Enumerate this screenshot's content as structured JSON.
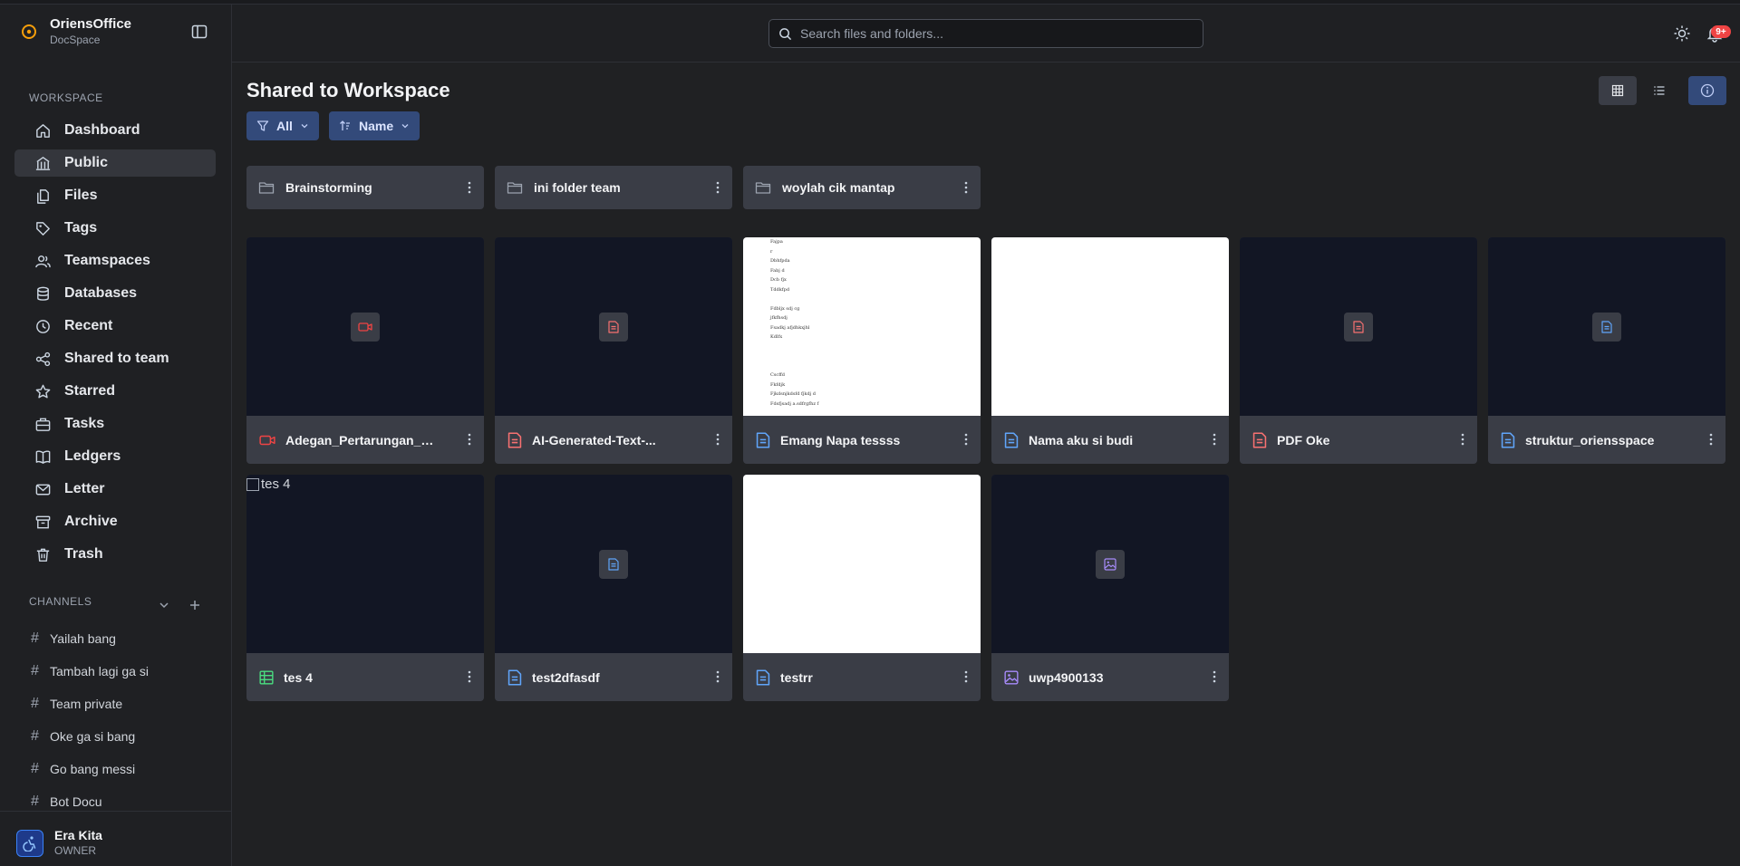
{
  "app": {
    "name": "OriensOffice",
    "product": "DocSpace"
  },
  "sidebar": {
    "workspace_title": "WORKSPACE",
    "items": [
      {
        "label": "Dashboard",
        "icon": "home-icon"
      },
      {
        "label": "Public",
        "icon": "building-icon",
        "active": true
      },
      {
        "label": "Files",
        "icon": "files-icon"
      },
      {
        "label": "Tags",
        "icon": "tag-icon"
      },
      {
        "label": "Teamspaces",
        "icon": "users-icon"
      },
      {
        "label": "Databases",
        "icon": "database-icon"
      },
      {
        "label": "Recent",
        "icon": "clock-icon"
      },
      {
        "label": "Shared to team",
        "icon": "share-icon"
      },
      {
        "label": "Starred",
        "icon": "star-icon"
      },
      {
        "label": "Tasks",
        "icon": "briefcase-icon"
      },
      {
        "label": "Ledgers",
        "icon": "book-icon"
      },
      {
        "label": "Letter",
        "icon": "mail-icon"
      },
      {
        "label": "Archive",
        "icon": "archive-icon"
      },
      {
        "label": "Trash",
        "icon": "trash-icon"
      }
    ],
    "channels_title": "CHANNELS",
    "channels": [
      {
        "label": "Yailah bang"
      },
      {
        "label": "Tambah lagi ga si"
      },
      {
        "label": "Team private"
      },
      {
        "label": "Oke ga si bang"
      },
      {
        "label": "Go bang messi"
      },
      {
        "label": "Bot Docu"
      }
    ]
  },
  "user": {
    "name": "Era Kita",
    "role": "OWNER"
  },
  "header": {
    "search_placeholder": "Search files and folders...",
    "notification_count": "9+"
  },
  "main": {
    "title": "Shared to Workspace",
    "filter_label": "All",
    "sort_label": "Name",
    "folders": [
      {
        "name": "Brainstorming"
      },
      {
        "name": "ini folder team"
      },
      {
        "name": "woylah cik mantap"
      }
    ],
    "files": [
      {
        "name": "Adegan_Pertarungan_Sp...",
        "type": "video",
        "icon": "video-icon",
        "icon_color": "#ef4444"
      },
      {
        "name": "AI-Generated-Text-...",
        "type": "pdf",
        "icon": "file-pdf-icon",
        "icon_color": "#f87171"
      },
      {
        "name": "Emang Napa tessss",
        "type": "doc",
        "icon": "file-doc-icon",
        "icon_color": "#60a5fa",
        "preview_lines": [
          "Fajpa",
          "r",
          "Dbhfpda",
          "Fabj d",
          "Dcb fjx",
          "Tddkfpd",
          "",
          "Fdbljx sdj cg",
          "jfkfhsdj",
          "Fsadkj afjdhkxjhl",
          "Kdlfx",
          "",
          "",
          "",
          "Cscffd",
          "Fkfdjk",
          "Fjkdsnjkdsfd fjkdj d",
          "Fdsfjsadj a.sdfrgfhz f"
        ]
      },
      {
        "name": "Nama aku si budi",
        "type": "doc",
        "icon": "file-doc-icon",
        "icon_color": "#60a5fa"
      },
      {
        "name": "PDF Oke",
        "type": "pdf",
        "icon": "file-pdf-icon",
        "icon_color": "#f87171"
      },
      {
        "name": "struktur_oriensspace",
        "type": "doc",
        "icon": "file-doc-icon",
        "icon_color": "#60a5fa"
      },
      {
        "name": "tes 4",
        "type": "sheet",
        "icon": "spreadsheet-icon",
        "icon_color": "#4ade80",
        "broken_image_alt": "tes 4"
      },
      {
        "name": "test2dfasdf",
        "type": "doc",
        "icon": "file-doc-icon",
        "icon_color": "#60a5fa"
      },
      {
        "name": "testrr",
        "type": "doc",
        "icon": "file-doc-icon",
        "icon_color": "#60a5fa"
      },
      {
        "name": "uwp4900133",
        "type": "image",
        "icon": "image-icon",
        "icon_color": "#a78bfa"
      }
    ]
  },
  "colors": {
    "accent": "#3b5998",
    "danger": "#ef4444",
    "doc": "#60a5fa",
    "pdf": "#f87171",
    "sheet": "#4ade80",
    "image": "#a78bfa"
  }
}
